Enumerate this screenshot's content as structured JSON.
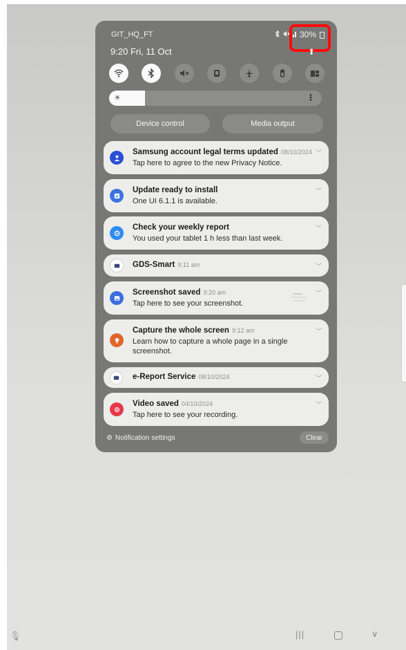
{
  "status": {
    "network": "GIT_HQ_FT",
    "battery": "30%",
    "time": "9:20",
    "date": "Fri, 11 Oct",
    "icons": [
      "bluetooth-icon",
      "mute-icon",
      "signal-icon",
      "battery-icon"
    ]
  },
  "quick_settings": [
    {
      "name": "wifi-icon",
      "on": true
    },
    {
      "name": "bluetooth-icon",
      "on": true
    },
    {
      "name": "sound-off-icon",
      "on": false
    },
    {
      "name": "rotation-lock-icon",
      "on": false
    },
    {
      "name": "airplane-mode-icon",
      "on": false
    },
    {
      "name": "power-saving-icon",
      "on": false
    },
    {
      "name": "multi-window-icon",
      "on": false
    }
  ],
  "brightness": {
    "level": 0.17
  },
  "buttons": {
    "device_control": "Device control",
    "media_output": "Media output"
  },
  "notifications": [
    {
      "title": "Samsung account legal terms updated",
      "time": "08/10/2024",
      "body": "Tap here to agree to the new Privacy Notice.",
      "icon": "samsung-account-icon",
      "color": "#2a4fd6"
    },
    {
      "title": "Update ready to install",
      "time": "",
      "body": "One UI 6.1.1 is available.",
      "icon": "software-update-icon",
      "color": "#3d74e0"
    },
    {
      "title": "Check your weekly report",
      "time": "",
      "body": "You used your tablet 1 h less than last week.",
      "icon": "digital-wellbeing-icon",
      "color": "#2f8cf0"
    },
    {
      "title": "GDS-Smart",
      "time": "9:11 am",
      "body": "",
      "icon": "gds-smart-icon",
      "color": "#3a4a78"
    },
    {
      "title": "Screenshot saved",
      "time": "9:20 am",
      "body": "Tap here to see your screenshot.",
      "icon": "gallery-icon",
      "color": "#3a6fe0"
    },
    {
      "title": "Capture the whole screen",
      "time": "9:12 am",
      "body": "Learn how to capture a whole page in a single screenshot.",
      "icon": "tips-icon",
      "color": "#e0662a"
    },
    {
      "title": "e-Report Service",
      "time": "08/10/2024",
      "body": "",
      "icon": "ereport-icon",
      "color": "#3a4a78"
    },
    {
      "title": "Video saved",
      "time": "04/10/2024",
      "body": "Tap here to see your recording.",
      "icon": "screen-recorder-icon",
      "color": "#e5394a"
    }
  ],
  "footer": {
    "settings": "Notification settings",
    "clear": "Clear"
  },
  "colors": {
    "highlight": "#ff0a0a",
    "panel": "#777876",
    "card": "#ededec"
  }
}
